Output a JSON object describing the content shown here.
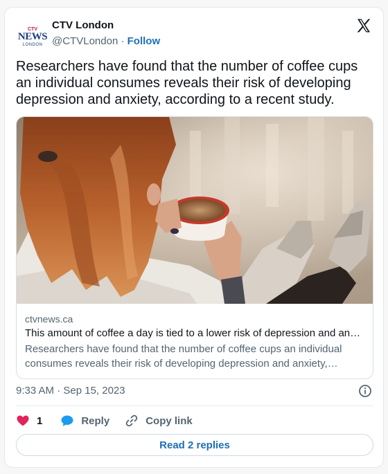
{
  "author": {
    "name": "CTV London",
    "handle": "@CTVLondon",
    "separator": " · ",
    "follow_label": "Follow",
    "avatar_logo": {
      "ctv": "CTV",
      "news": "NEWS",
      "city": "LONDON"
    }
  },
  "tweet": {
    "text": "Researchers have found that the number of coffee cups an individual consumes reveals their risk of developing depression and anxiety, according to a recent study."
  },
  "link_card": {
    "domain": "ctvnews.ca",
    "title": "This amount of coffee a day is tied to a lower risk of depression and anxiety",
    "description": "Researchers have found that the number of coffee cups an individual consumes reveals their risk of developing depression and anxiety, according to a recent study.",
    "image_subject": "woman holding a cup of coffee"
  },
  "timestamp": "9:33 AM · Sep 15, 2023",
  "actions": {
    "like_count": "1",
    "reply_label": "Reply",
    "copy_link_label": "Copy link"
  },
  "read_replies_label": "Read 2 replies",
  "colors": {
    "accent": "#1d6fb8",
    "heart": "#e0245e",
    "reply_bubble": "#1d9bf0",
    "muted": "#536471"
  },
  "icons": [
    "x-logo-icon",
    "info-icon",
    "heart-icon",
    "reply-bubble-icon",
    "link-icon"
  ]
}
